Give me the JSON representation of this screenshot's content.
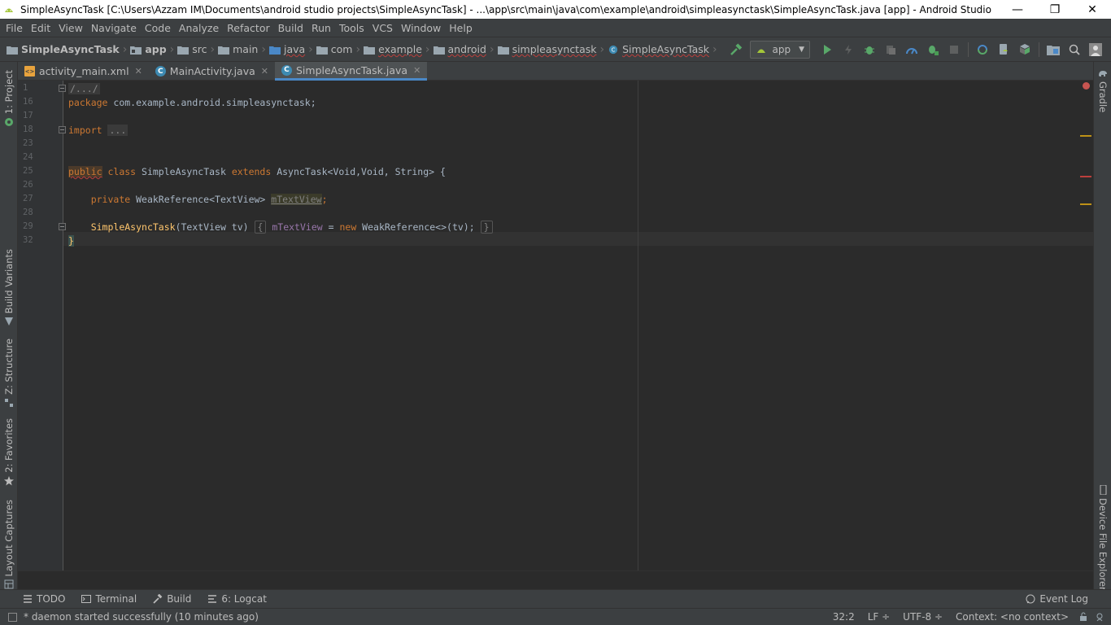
{
  "window": {
    "title": "SimpleAsyncTask [C:\\Users\\Azzam IM\\Documents\\android studio projects\\SimpleAsyncTask] - ...\\app\\src\\main\\java\\com\\example\\android\\simpleasynctask\\SimpleAsyncTask.java [app] - Android Studio",
    "minimize": "—",
    "restore": "❐",
    "close": "✕"
  },
  "menu": [
    "File",
    "Edit",
    "View",
    "Navigate",
    "Code",
    "Analyze",
    "Refactor",
    "Build",
    "Run",
    "Tools",
    "VCS",
    "Window",
    "Help"
  ],
  "breadcrumbs": [
    "SimpleAsyncTask",
    "app",
    "src",
    "main",
    "java",
    "com",
    "example",
    "android",
    "simpleasynctask",
    "SimpleAsyncTask"
  ],
  "run_config": "app",
  "tabs": [
    {
      "label": "activity_main.xml",
      "icon": "xml-file-icon"
    },
    {
      "label": "MainActivity.java",
      "icon": "class-icon"
    },
    {
      "label": "SimpleAsyncTask.java",
      "icon": "class-icon",
      "active": true
    }
  ],
  "left_tools": [
    "1: Project",
    "Build Variants",
    "Z: Structure",
    "2: Favorites",
    "Layout Captures"
  ],
  "right_tools": [
    "Gradle",
    "Device File Explorer"
  ],
  "line_numbers": [
    "1",
    "16",
    "17",
    "18",
    "23",
    "24",
    "25",
    "26",
    "27",
    "28",
    "29",
    "32"
  ],
  "code": {
    "l1": "/.../",
    "l16_kw": "package",
    "l16_rest": " com.example.android.simpleasynctask;",
    "l18_kw": "import",
    "l18_fold": "...",
    "l25_public": "public",
    "l25_class": "class",
    "l25_name": " SimpleAsyncTask ",
    "l25_extends": "extends",
    "l25_rest": " AsyncTask<Void,Void, String> {",
    "l27_kw": "private",
    "l27_type": " WeakReference<TextView> ",
    "l27_field": "mTextView",
    "l27_end": ";",
    "l29_fn": "SimpleAsyncTask",
    "l29_params": "(TextView tv) ",
    "l29_open": "{",
    "l29_field": " mTextView",
    "l29_eq": " = ",
    "l29_new": "new",
    "l29_rest": " WeakReference<>(tv); ",
    "l29_close": "}",
    "l32": "}"
  },
  "bottom_tools": [
    "TODO",
    "Terminal",
    "Build",
    "6: Logcat"
  ],
  "event_log": "Event Log",
  "status": {
    "message": "* daemon started successfully (10 minutes ago)",
    "position": "32:2",
    "line_sep": "LF ÷",
    "encoding": "UTF-8 ÷",
    "context": "Context: <no context>"
  },
  "colors": {
    "accent": "#4a88c7",
    "keyword": "#cc7832",
    "function": "#ffc66d",
    "field": "#9876aa",
    "error": "#bc3f3c",
    "run_green": "#59a869"
  }
}
